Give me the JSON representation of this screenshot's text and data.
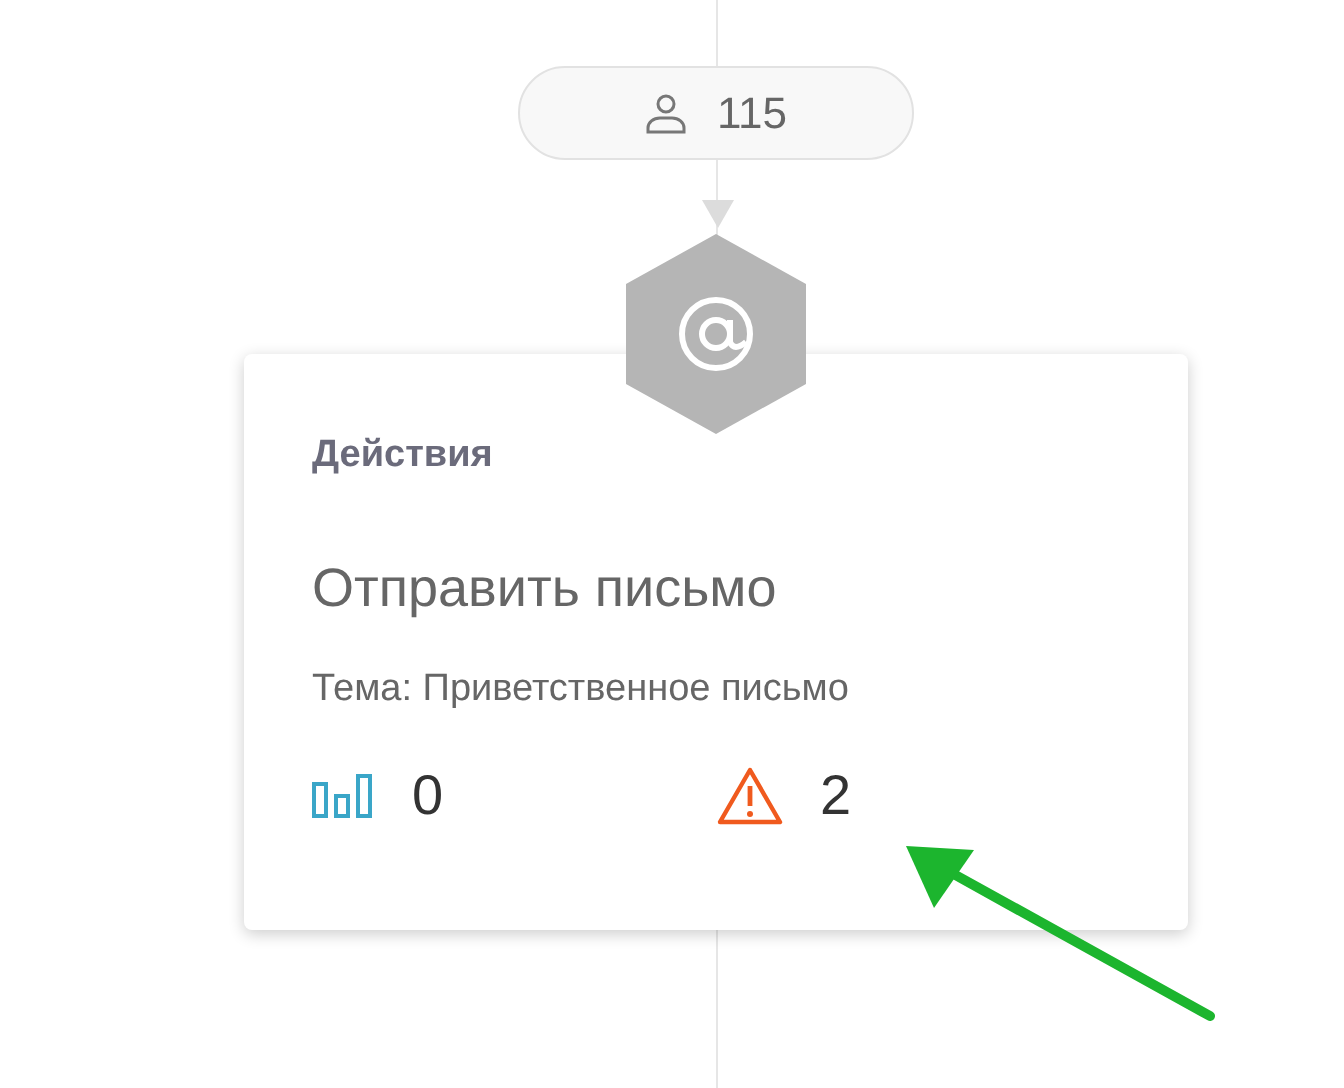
{
  "audience_pill": {
    "count": "115"
  },
  "action_card": {
    "category": "Действия",
    "title": "Отправить письмо",
    "subject": "Тема: Приветственное письмо",
    "stats": [
      {
        "kind": "stats",
        "value": "0"
      },
      {
        "kind": "warnings",
        "value": "2"
      }
    ]
  },
  "annotation": {
    "kind": "arrow"
  }
}
